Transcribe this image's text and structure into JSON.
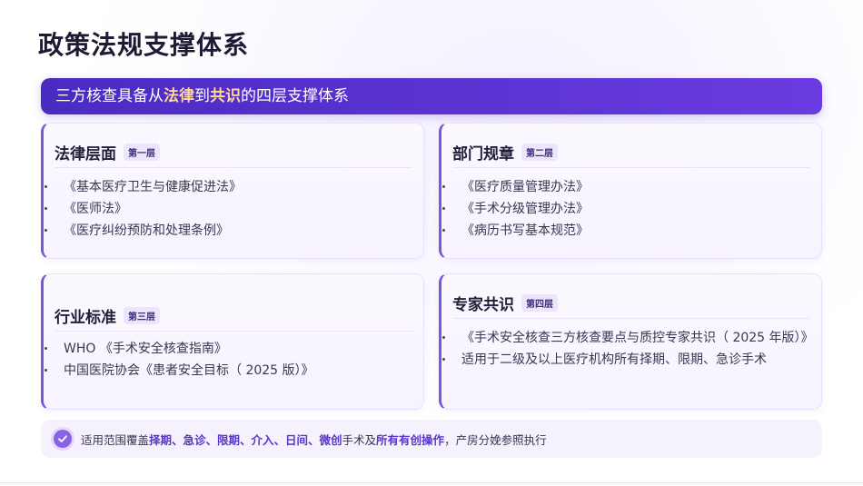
{
  "page_title": "政策法规支撑体系",
  "banner": {
    "pre": "三方核查具备从",
    "hl1": "法律",
    "mid": "到",
    "hl2": "共识",
    "post": "的四层支撑体系"
  },
  "cards": [
    {
      "title": "法律层面",
      "badge": "第一层",
      "items": [
        "《基本医疗卫生与健康促进法》",
        "《医师法》",
        "《医疗纠纷预防和处理条例》"
      ]
    },
    {
      "title": "部门规章",
      "badge": "第二层",
      "items": [
        "《医疗质量管理办法》",
        "《手术分级管理办法》",
        "《病历书写基本规范》"
      ]
    },
    {
      "title": "行业标准",
      "badge": "第三层",
      "items": [
        "WHO 《手术安全核查指南》",
        "中国医院协会《患者安全目标（ 2025 版）》"
      ]
    },
    {
      "title": "专家共识",
      "badge": "第四层",
      "items": [
        "《手术安全核查三方核查要点与质控专家共识（ 2025 年版）》",
        "适用于二级及以上医疗机构所有择期、限期、急诊手术"
      ]
    }
  ],
  "bottom": {
    "t1": "适用范围覆盖",
    "e1": "择期、急诊、限期、介入、日间、微创",
    "t2": "手术及",
    "e2": "所有有创操作",
    "t3": "，产房分娩参照执行"
  },
  "colors": {
    "accent": "#5a35c9",
    "banner_start": "#4a2bc2",
    "banner_end": "#6a3be0",
    "highlight": "#ffd89a"
  }
}
